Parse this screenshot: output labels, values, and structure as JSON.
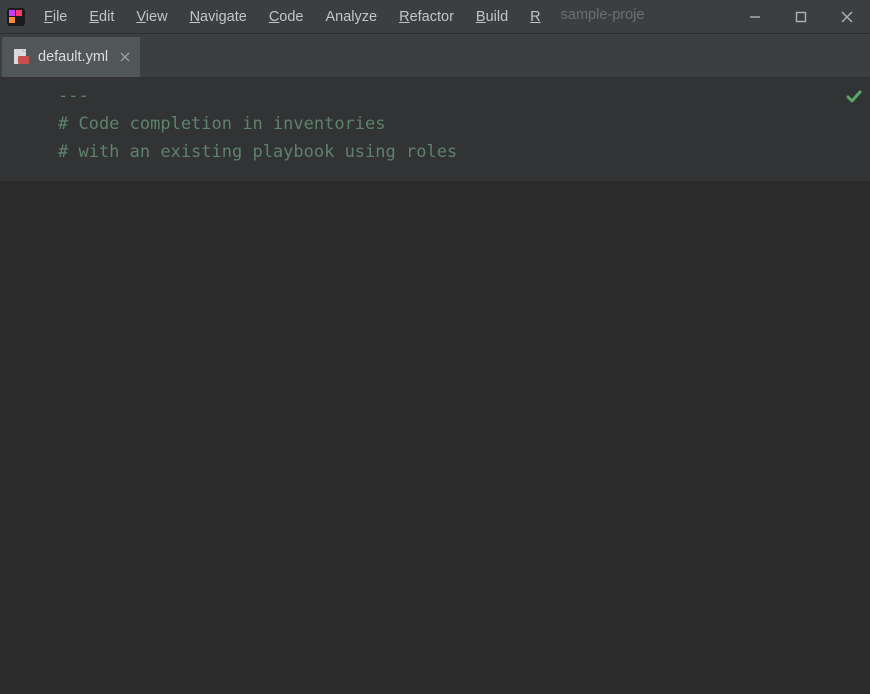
{
  "menus": {
    "file": {
      "u": "F",
      "rest": "ile"
    },
    "edit": {
      "u": "E",
      "rest": "dit"
    },
    "view": {
      "u": "V",
      "rest": "iew"
    },
    "navigate": {
      "u": "N",
      "rest": "avigate"
    },
    "code": {
      "u": "C",
      "rest": "ode"
    },
    "analyze": {
      "u": "",
      "rest": "Analyze"
    },
    "refactor": {
      "u": "R",
      "rest": "efactor"
    },
    "build": {
      "u": "B",
      "rest": "uild"
    },
    "run": {
      "u": "R",
      "rest": ""
    }
  },
  "search_placeholder": "sample-proje",
  "tab": {
    "filename": "default.yml"
  },
  "code": {
    "l1": "---",
    "l2": "# Code completion in inventories",
    "l3": "# with an existing playbook using roles"
  }
}
